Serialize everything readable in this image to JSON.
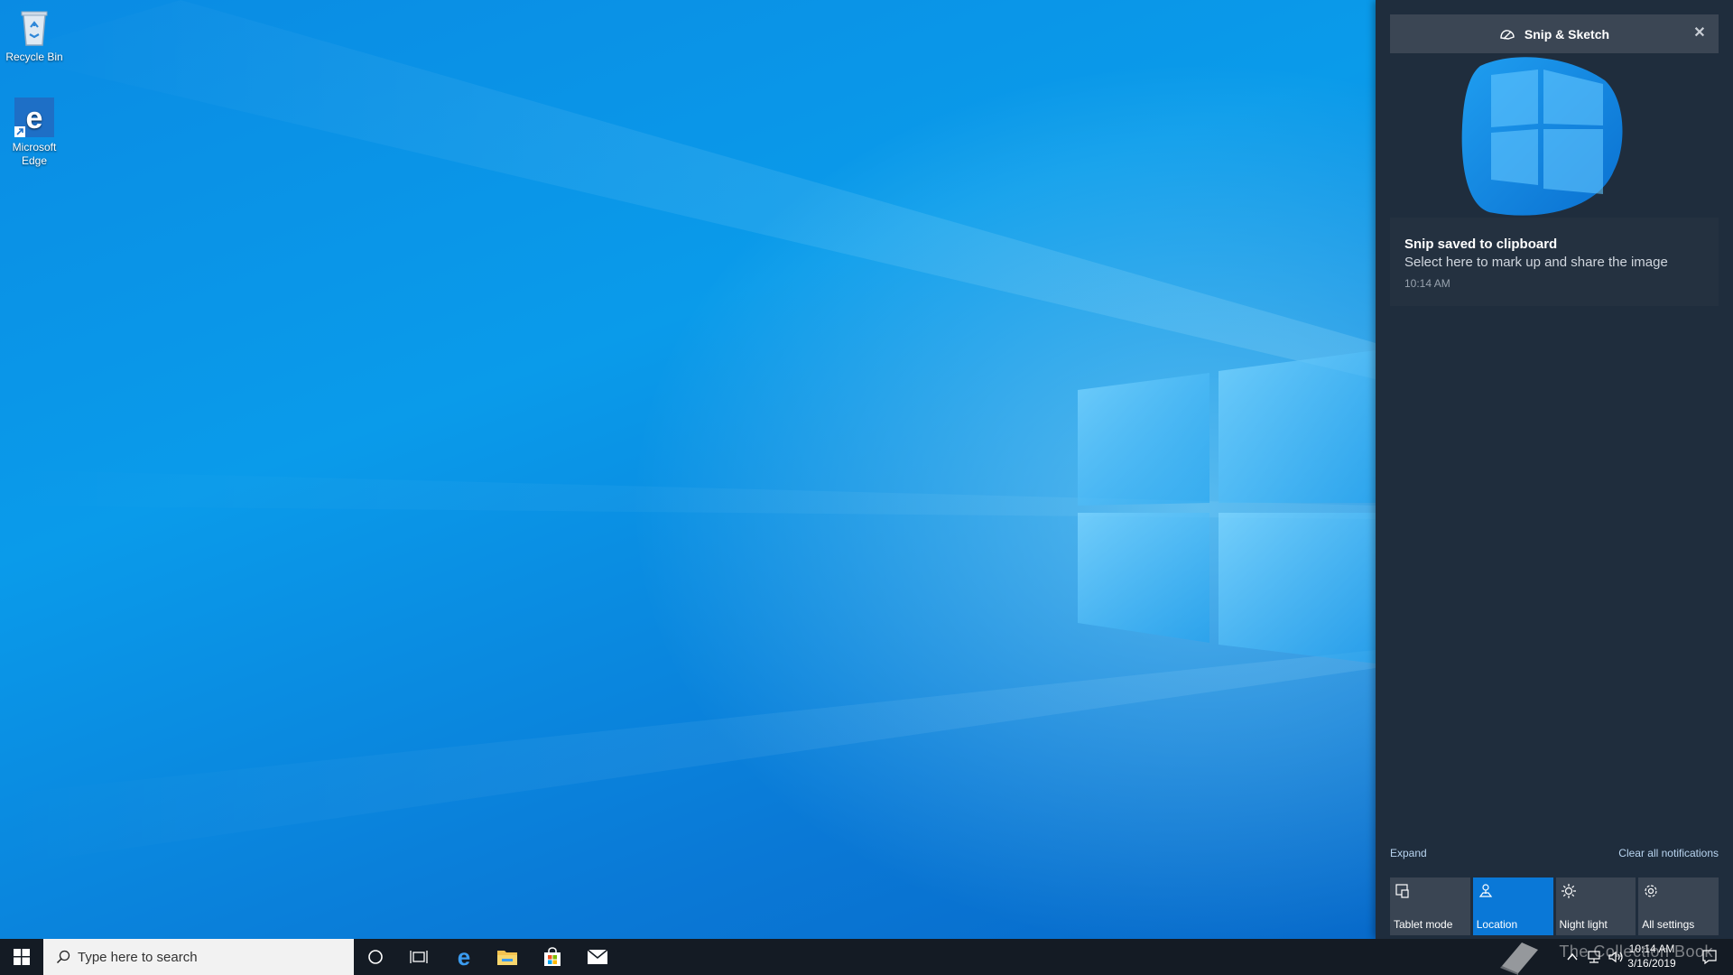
{
  "desktop": {
    "icons": [
      {
        "label": "Recycle Bin"
      },
      {
        "label": "Microsoft Edge"
      }
    ]
  },
  "notification": {
    "app_name": "Snip & Sketch",
    "title": "Snip saved to clipboard",
    "text": "Select here to mark up and share the image",
    "time": "10:14 AM"
  },
  "action_center": {
    "expand_label": "Expand",
    "clear_label": "Clear all notifications",
    "quick_actions": [
      {
        "label": "Tablet mode",
        "icon": "tablet-icon",
        "active": false
      },
      {
        "label": "Location",
        "icon": "location-icon",
        "active": true
      },
      {
        "label": "Night light",
        "icon": "sun-icon",
        "active": false
      },
      {
        "label": "All settings",
        "icon": "gear-icon",
        "active": false
      }
    ]
  },
  "taskbar": {
    "search_placeholder": "Type here to search",
    "clock_time": "10:14 AM",
    "clock_date": "3/16/2019",
    "watermark": "The Collection Book"
  },
  "colors": {
    "accent": "#0a78d7",
    "action_center_bg": "#1f2d3d",
    "taskbar_bg": "#141b24"
  }
}
